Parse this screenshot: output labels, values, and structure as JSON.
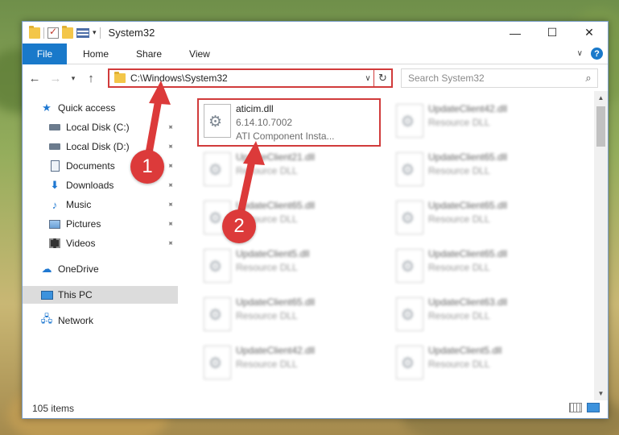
{
  "window": {
    "title": "System32"
  },
  "ribbon": {
    "file": "File",
    "tabs": [
      "Home",
      "Share",
      "View"
    ],
    "help": "?"
  },
  "navigation": {
    "address": "C:\\Windows\\System32",
    "search_placeholder": "Search System32"
  },
  "sidebar": {
    "items": [
      {
        "label": "Quick access",
        "icon": "star-icon"
      },
      {
        "label": "Local Disk (C:)",
        "icon": "drive-icon",
        "pinned": true
      },
      {
        "label": "Local Disk (D:)",
        "icon": "drive-icon",
        "pinned": true
      },
      {
        "label": "Documents",
        "icon": "documents-icon",
        "pinned": true
      },
      {
        "label": "Downloads",
        "icon": "download-icon",
        "pinned": true
      },
      {
        "label": "Music",
        "icon": "music-icon",
        "pinned": true
      },
      {
        "label": "Pictures",
        "icon": "pictures-icon",
        "pinned": true
      },
      {
        "label": "Videos",
        "icon": "videos-icon",
        "pinned": true
      },
      {
        "label": "OneDrive",
        "icon": "cloud-icon"
      },
      {
        "label": "This PC",
        "icon": "pc-icon",
        "selected": true
      },
      {
        "label": "Network",
        "icon": "network-icon"
      }
    ]
  },
  "files": {
    "primary": {
      "name": "aticim.dll",
      "version": "6.14.10.7002",
      "description": "ATI Component Insta..."
    },
    "others": [
      {
        "name": "UpdateClient42.dll",
        "description": "Resource DLL"
      },
      {
        "name": "UpdateClient21.dll",
        "description": "Resource DLL"
      },
      {
        "name": "UpdateClient65.dll",
        "description": "Resource DLL"
      },
      {
        "name": "UpdateClient65.dll",
        "description": "Resource DLL"
      },
      {
        "name": "UpdateClient65.dll",
        "description": "Resource DLL"
      },
      {
        "name": "UpdateClient5.dll",
        "description": "Resource DLL"
      },
      {
        "name": "UpdateClient65.dll",
        "description": "Resource DLL"
      },
      {
        "name": "UpdateClient65.dll",
        "description": "Resource DLL"
      },
      {
        "name": "UpdateClient63.dll",
        "description": "Resource DLL"
      },
      {
        "name": "UpdateClient42.dll",
        "description": "Resource DLL"
      },
      {
        "name": "UpdateClient5.dll",
        "description": "Resource DLL"
      }
    ]
  },
  "status": {
    "count": "105 items"
  },
  "annotations": {
    "step1": "1",
    "step2": "2"
  },
  "colors": {
    "accent": "#1979ca",
    "highlight": "#d13b3b",
    "badge": "#dc3a3a"
  }
}
